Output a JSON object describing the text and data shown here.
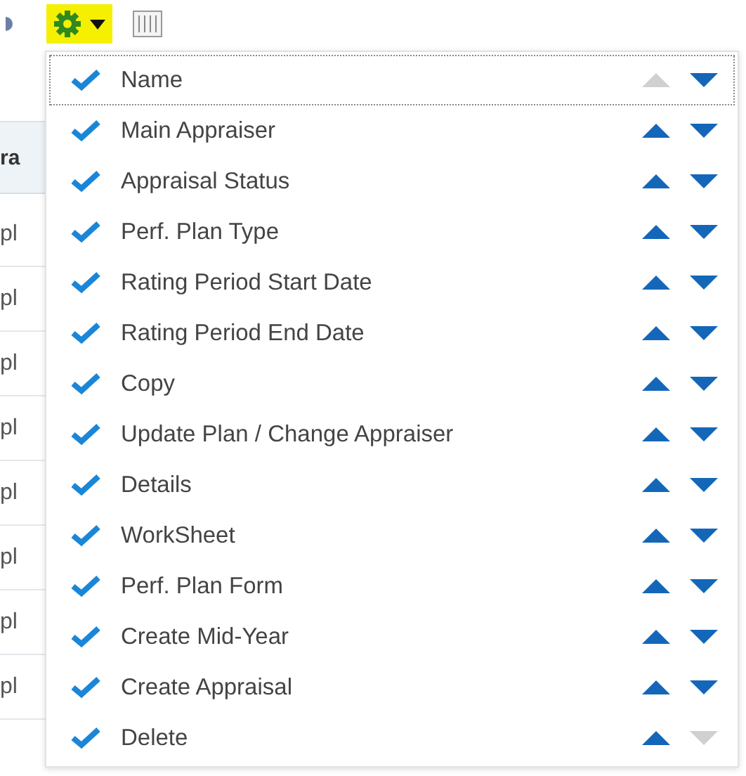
{
  "toolbar": {
    "settings_highlighted": true
  },
  "background_table": {
    "header": "ra",
    "rows": [
      "pl",
      "pl",
      "pl",
      "pl",
      "pl",
      "pl",
      "pl",
      "pl"
    ]
  },
  "column_menu": [
    {
      "label": "Name",
      "checked": true,
      "focused": true,
      "up_enabled": false,
      "down_enabled": true
    },
    {
      "label": "Main Appraiser",
      "checked": true,
      "focused": false,
      "up_enabled": true,
      "down_enabled": true
    },
    {
      "label": "Appraisal Status",
      "checked": true,
      "focused": false,
      "up_enabled": true,
      "down_enabled": true
    },
    {
      "label": "Perf. Plan Type",
      "checked": true,
      "focused": false,
      "up_enabled": true,
      "down_enabled": true
    },
    {
      "label": "Rating Period Start Date",
      "checked": true,
      "focused": false,
      "up_enabled": true,
      "down_enabled": true
    },
    {
      "label": "Rating Period End Date",
      "checked": true,
      "focused": false,
      "up_enabled": true,
      "down_enabled": true
    },
    {
      "label": "Copy",
      "checked": true,
      "focused": false,
      "up_enabled": true,
      "down_enabled": true
    },
    {
      "label": "Update Plan / Change Appraiser",
      "checked": true,
      "focused": false,
      "up_enabled": true,
      "down_enabled": true
    },
    {
      "label": "Details",
      "checked": true,
      "focused": false,
      "up_enabled": true,
      "down_enabled": true
    },
    {
      "label": "WorkSheet",
      "checked": true,
      "focused": false,
      "up_enabled": true,
      "down_enabled": true
    },
    {
      "label": "Perf. Plan Form",
      "checked": true,
      "focused": false,
      "up_enabled": true,
      "down_enabled": true
    },
    {
      "label": "Create Mid-Year",
      "checked": true,
      "focused": false,
      "up_enabled": true,
      "down_enabled": true
    },
    {
      "label": "Create Appraisal",
      "checked": true,
      "focused": false,
      "up_enabled": true,
      "down_enabled": true
    },
    {
      "label": "Delete",
      "checked": true,
      "focused": false,
      "up_enabled": true,
      "down_enabled": false
    }
  ]
}
